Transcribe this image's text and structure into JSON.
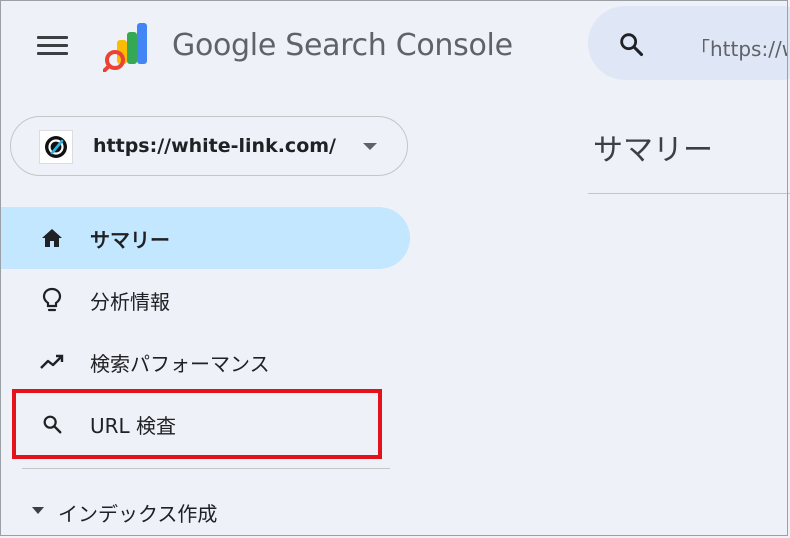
{
  "header": {
    "product_name": "Google Search Console",
    "search_text": "「https://w"
  },
  "property": {
    "url": "https://white-link.com/"
  },
  "main": {
    "page_title": "サマリー"
  },
  "sidebar": {
    "items": [
      {
        "label": "サマリー",
        "icon": "home-icon",
        "active": true
      },
      {
        "label": "分析情報",
        "icon": "lightbulb-icon",
        "active": false
      },
      {
        "label": "検索パフォーマンス",
        "icon": "trending-up-icon",
        "active": false
      },
      {
        "label": "URL 検査",
        "icon": "search-icon",
        "active": false
      }
    ],
    "section": {
      "label": "インデックス作成",
      "icon": "arrow-drop-down-icon"
    }
  },
  "colors": {
    "background": "#eef1f8",
    "active_nav": "#c2e7ff",
    "highlight": "#e4121b",
    "search_box": "#dfe6f5"
  }
}
